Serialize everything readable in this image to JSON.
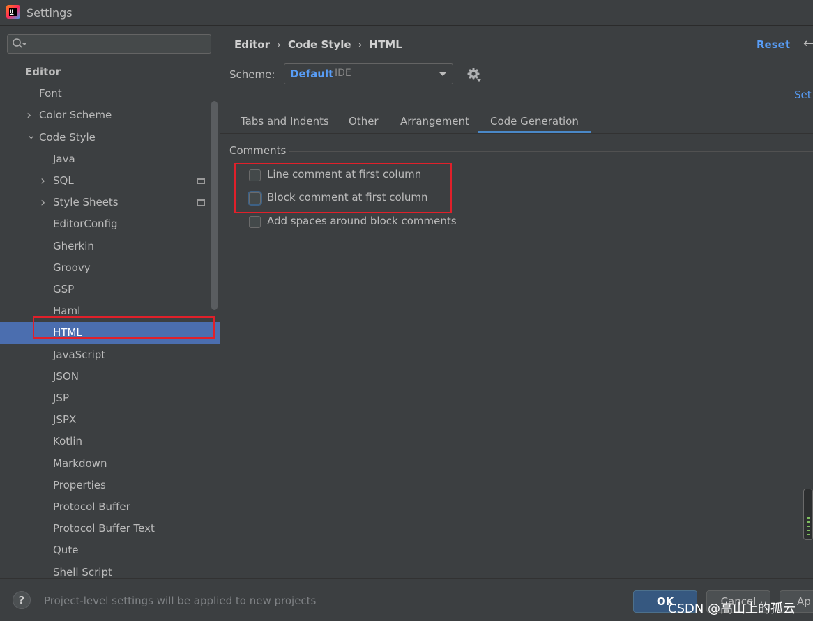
{
  "window": {
    "title": "Settings",
    "icon": "intellij-idea-icon"
  },
  "sidebar": {
    "search": {
      "value": "",
      "placeholder": "",
      "icon": "search-icon"
    },
    "items": [
      {
        "label": "Editor",
        "level": 0,
        "bold": true
      },
      {
        "label": "Font",
        "level": 1
      },
      {
        "label": "Color Scheme",
        "level": 1,
        "expander": "collapsed"
      },
      {
        "label": "Code Style",
        "level": 1,
        "expander": "expanded"
      },
      {
        "label": "Java",
        "level": 2
      },
      {
        "label": "SQL",
        "level": 2,
        "expander": "collapsed",
        "project_icon": true
      },
      {
        "label": "Style Sheets",
        "level": 2,
        "expander": "collapsed",
        "project_icon": true
      },
      {
        "label": "EditorConfig",
        "level": 2
      },
      {
        "label": "Gherkin",
        "level": 2
      },
      {
        "label": "Groovy",
        "level": 2
      },
      {
        "label": "GSP",
        "level": 2
      },
      {
        "label": "Haml",
        "level": 2
      },
      {
        "label": "HTML",
        "level": 2,
        "selected": true
      },
      {
        "label": "JavaScript",
        "level": 2
      },
      {
        "label": "JSON",
        "level": 2
      },
      {
        "label": "JSP",
        "level": 2
      },
      {
        "label": "JSPX",
        "level": 2
      },
      {
        "label": "Kotlin",
        "level": 2
      },
      {
        "label": "Markdown",
        "level": 2
      },
      {
        "label": "Properties",
        "level": 2
      },
      {
        "label": "Protocol Buffer",
        "level": 2
      },
      {
        "label": "Protocol Buffer Text",
        "level": 2
      },
      {
        "label": "Qute",
        "level": 2
      },
      {
        "label": "Shell Script",
        "level": 2
      }
    ]
  },
  "content": {
    "breadcrumb": [
      "Editor",
      "Code Style",
      "HTML"
    ],
    "breadcrumb_separator": "›",
    "reset_label": "Reset",
    "back_icon": "←",
    "scheme": {
      "label": "Scheme:",
      "value": "Default",
      "kind": "IDE"
    },
    "set_from_label": "Set",
    "tabs": [
      {
        "label": "Tabs and Indents",
        "active": false
      },
      {
        "label": "Other",
        "active": false
      },
      {
        "label": "Arrangement",
        "active": false
      },
      {
        "label": "Code Generation",
        "active": true
      }
    ],
    "comments": {
      "title": "Comments",
      "options": [
        {
          "label": "Line comment at first column",
          "checked": false
        },
        {
          "label": "Block comment at first column",
          "checked": false,
          "focused": true
        },
        {
          "label": "Add spaces around block comments",
          "checked": false
        }
      ]
    }
  },
  "footer": {
    "help_label": "?",
    "note": "Project-level settings will be applied to new projects",
    "ok_label": "OK",
    "cancel_label": "Cancel",
    "apply_label": "Ap"
  },
  "watermark": "CSDN @高山上的孤云",
  "colors": {
    "background": "#3c3f41",
    "selection": "#4b6eaf",
    "accent_link": "#589df6",
    "highlight_box": "#e0202a"
  }
}
